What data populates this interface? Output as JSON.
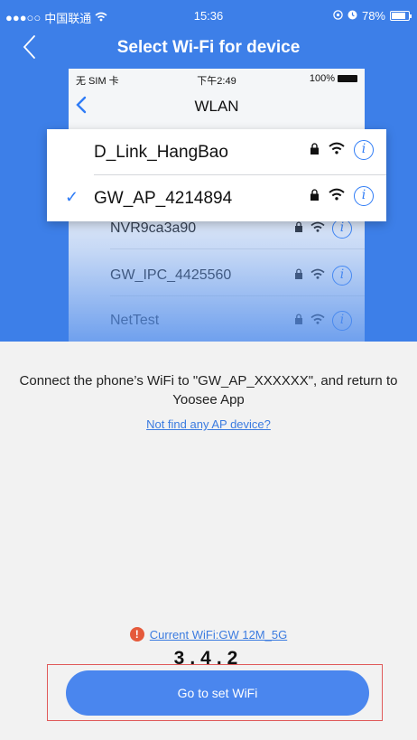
{
  "status_bar": {
    "signal": "●●●○○",
    "carrier": "中国联通",
    "time": "15:36",
    "battery": "78%"
  },
  "navbar": {
    "title": "Select Wi-Fi for device",
    "back_icon": "chevron-left-icon"
  },
  "illustration": {
    "status": {
      "sim": "无 SIM 卡",
      "time": "下午2:49",
      "battery": "100%"
    },
    "nav_title": "WLAN",
    "highlight_networks": [
      {
        "name": "D_Link_HangBao",
        "selected": false
      },
      {
        "name": "GW_AP_4214894",
        "selected": true
      }
    ],
    "other_networks": [
      "NVR9ca3a90",
      "GW_IPC_4425560",
      "NetTest"
    ],
    "icons": [
      "lock-icon",
      "wifi-icon",
      "info-icon"
    ]
  },
  "instruction": "Connect the phone’s WiFi to \"GW_AP_XXXXXX\", and return to  Yoosee  App",
  "help_link": "Not find any AP device?",
  "current_wifi": {
    "warning_icon": "warning-icon",
    "text": "Current WiFi:GW 12M_5G"
  },
  "version": "3.4.2",
  "primary_button": "Go to set WiFi",
  "colors": {
    "header_blue": "#3d7fe8",
    "button_blue": "#4a86ee",
    "link_blue": "#3b7be0",
    "warning_red": "#e55a3b",
    "outline_red": "#e05a5a"
  }
}
